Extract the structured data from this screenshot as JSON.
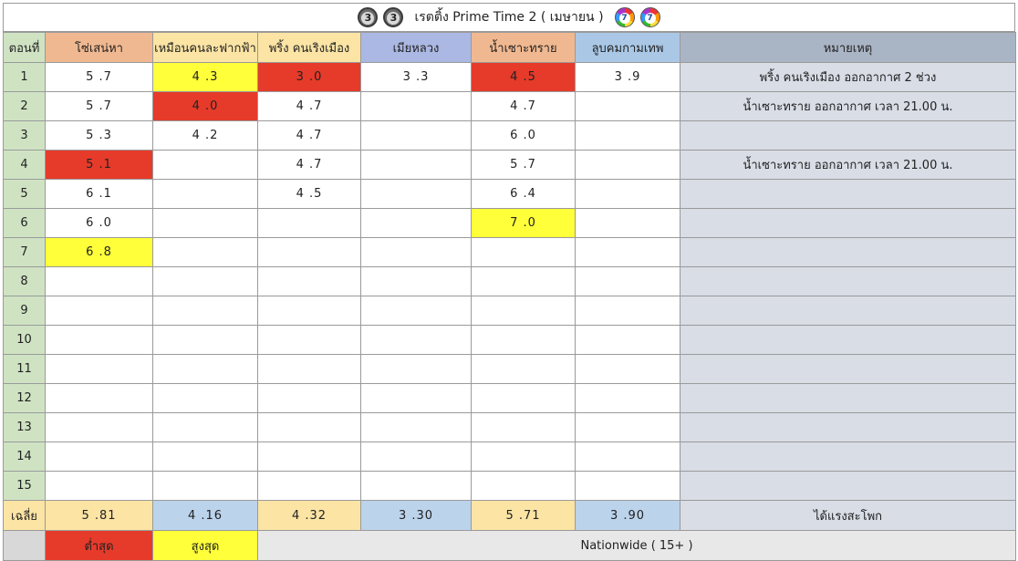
{
  "title": {
    "left_logo": "channel-3-logo",
    "left_logo_text": "3",
    "text": "เรตติ้ง Prime Time 2 ( เมษายน )",
    "right_logo": "channel-7-logo",
    "right_logo_text": "7"
  },
  "columns": {
    "episode": "ตอนที่",
    "show1": "โซ่เสน่หา",
    "show2": "เหมือนคนละฟากฟ้า",
    "show3": "พริ้ง คนเริงเมือง",
    "show4": "เมียหลวง",
    "show5": "น้ำเซาะทราย",
    "show6": "ลูบคมกามเทพ",
    "remarks": "หมายเหตุ"
  },
  "rows": [
    {
      "ep": "1",
      "s1": "5 .7",
      "s2": "4 .3",
      "s3": "3 .0",
      "s4": "3 .3",
      "s5": "4 .5",
      "s6": "3 .9",
      "remark": "พริ้ง คนเริงเมือง ออกอากาศ 2 ช่วง"
    },
    {
      "ep": "2",
      "s1": "5 .7",
      "s2": "4 .0",
      "s3": "4 .7",
      "s4": "",
      "s5": "4 .7",
      "s6": "",
      "remark": "น้ำเซาะทราย ออกอากาศ เวลา 21.00 น."
    },
    {
      "ep": "3",
      "s1": "5 .3",
      "s2": "4 .2",
      "s3": "4 .7",
      "s4": "",
      "s5": "6 .0",
      "s6": "",
      "remark": ""
    },
    {
      "ep": "4",
      "s1": "5 .1",
      "s2": "",
      "s3": "4 .7",
      "s4": "",
      "s5": "5 .7",
      "s6": "",
      "remark": "น้ำเซาะทราย ออกอากาศ เวลา 21.00 น."
    },
    {
      "ep": "5",
      "s1": "6 .1",
      "s2": "",
      "s3": "4 .5",
      "s4": "",
      "s5": "6 .4",
      "s6": "",
      "remark": ""
    },
    {
      "ep": "6",
      "s1": "6 .0",
      "s2": "",
      "s3": "",
      "s4": "",
      "s5": "7 .0",
      "s6": "",
      "remark": ""
    },
    {
      "ep": "7",
      "s1": "6 .8",
      "s2": "",
      "s3": "",
      "s4": "",
      "s5": "",
      "s6": "",
      "remark": ""
    },
    {
      "ep": "8",
      "s1": "",
      "s2": "",
      "s3": "",
      "s4": "",
      "s5": "",
      "s6": "",
      "remark": ""
    },
    {
      "ep": "9",
      "s1": "",
      "s2": "",
      "s3": "",
      "s4": "",
      "s5": "",
      "s6": "",
      "remark": ""
    },
    {
      "ep": "10",
      "s1": "",
      "s2": "",
      "s3": "",
      "s4": "",
      "s5": "",
      "s6": "",
      "remark": ""
    },
    {
      "ep": "11",
      "s1": "",
      "s2": "",
      "s3": "",
      "s4": "",
      "s5": "",
      "s6": "",
      "remark": ""
    },
    {
      "ep": "12",
      "s1": "",
      "s2": "",
      "s3": "",
      "s4": "",
      "s5": "",
      "s6": "",
      "remark": ""
    },
    {
      "ep": "13",
      "s1": "",
      "s2": "",
      "s3": "",
      "s4": "",
      "s5": "",
      "s6": "",
      "remark": ""
    },
    {
      "ep": "14",
      "s1": "",
      "s2": "",
      "s3": "",
      "s4": "",
      "s5": "",
      "s6": "",
      "remark": ""
    },
    {
      "ep": "15",
      "s1": "",
      "s2": "",
      "s3": "",
      "s4": "",
      "s5": "",
      "s6": "",
      "remark": ""
    }
  ],
  "average": {
    "label": "เฉลี่ย",
    "s1": "5 .81",
    "s2": "4 .16",
    "s3": "4 .32",
    "s4": "3 .30",
    "s5": "5 .71",
    "s6": "3 .90",
    "remark": "ได้แรงสะโพก"
  },
  "legend": {
    "low": "ต่ำสุด",
    "high": "สูงสุด",
    "note": "Nationwide ( 15+ )"
  },
  "colors": {
    "lowest_highlight": "#e63a2a",
    "highest_highlight": "#ffff3a",
    "selected_cell_border": "#3a6a45",
    "episode_column": "#cfe3c3",
    "remarks_header": "#a9b4c4"
  }
}
